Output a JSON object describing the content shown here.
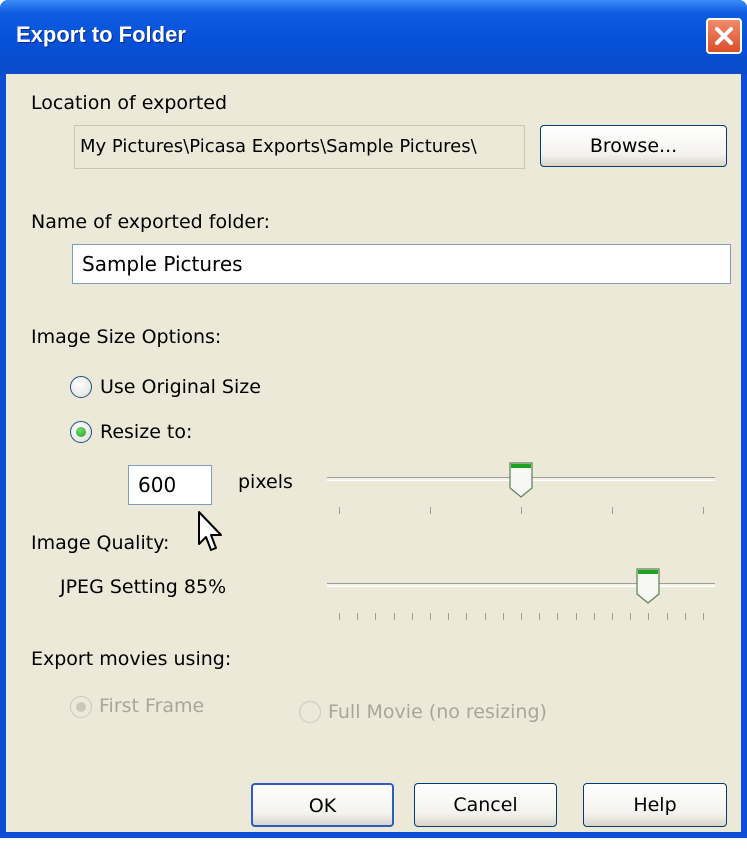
{
  "window": {
    "title": "Export to Folder"
  },
  "location": {
    "label": "Location of exported",
    "path": "My Pictures\\Picasa Exports\\Sample Pictures\\",
    "browse_label": "Browse..."
  },
  "folder": {
    "label": "Name of exported folder:",
    "value": "Sample Pictures"
  },
  "size": {
    "label": "Image Size Options:",
    "original_label": "Use Original Size",
    "resize_label": "Resize to:",
    "selected": "resize",
    "pixels_value": "600",
    "pixels_unit": "pixels",
    "slider_fraction": 0.5
  },
  "quality": {
    "label": "Image Quality:",
    "setting_text": "JPEG Setting 85%",
    "slider_fraction": 0.85
  },
  "movies": {
    "label": "Export movies using:",
    "first_frame_label": "First Frame",
    "full_movie_label": "Full Movie (no resizing)",
    "selected": "first_frame",
    "enabled": false
  },
  "buttons": {
    "ok": "OK",
    "cancel": "Cancel",
    "help": "Help"
  },
  "colors": {
    "titlebar": "#0650d8",
    "dialog_bg": "#ece9d8",
    "close": "#d9502a",
    "slider_thumb_accent": "#21a121"
  }
}
